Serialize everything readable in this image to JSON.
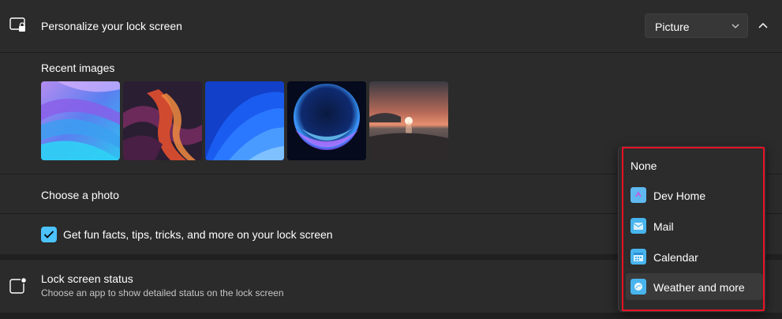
{
  "personalize": {
    "title": "Personalize your lock screen",
    "dropdown_value": "Picture"
  },
  "recent_images": {
    "label": "Recent images",
    "items": [
      "abstract-blue-purple-waves",
      "dark-red-ribbon",
      "blue-bloom",
      "blue-glow-sphere",
      "sunset-lake"
    ]
  },
  "choose_photo": {
    "label": "Choose a photo"
  },
  "fun_facts": {
    "label": "Get fun facts, tips, tricks, and more on your lock screen",
    "checked": true
  },
  "status": {
    "title": "Lock screen status",
    "description": "Choose an app to show detailed status on the lock screen"
  },
  "menu": {
    "items": [
      {
        "label": "None",
        "icon": ""
      },
      {
        "label": "Dev Home",
        "icon": "dev-home-icon"
      },
      {
        "label": "Mail",
        "icon": "mail-icon"
      },
      {
        "label": "Calendar",
        "icon": "calendar-icon"
      },
      {
        "label": "Weather and more",
        "icon": "weather-icon"
      }
    ],
    "selected_index": 4
  },
  "colors": {
    "accent": "#4cc2ff",
    "highlight": "#e81123",
    "background": "#202020",
    "card": "#2b2b2b"
  }
}
